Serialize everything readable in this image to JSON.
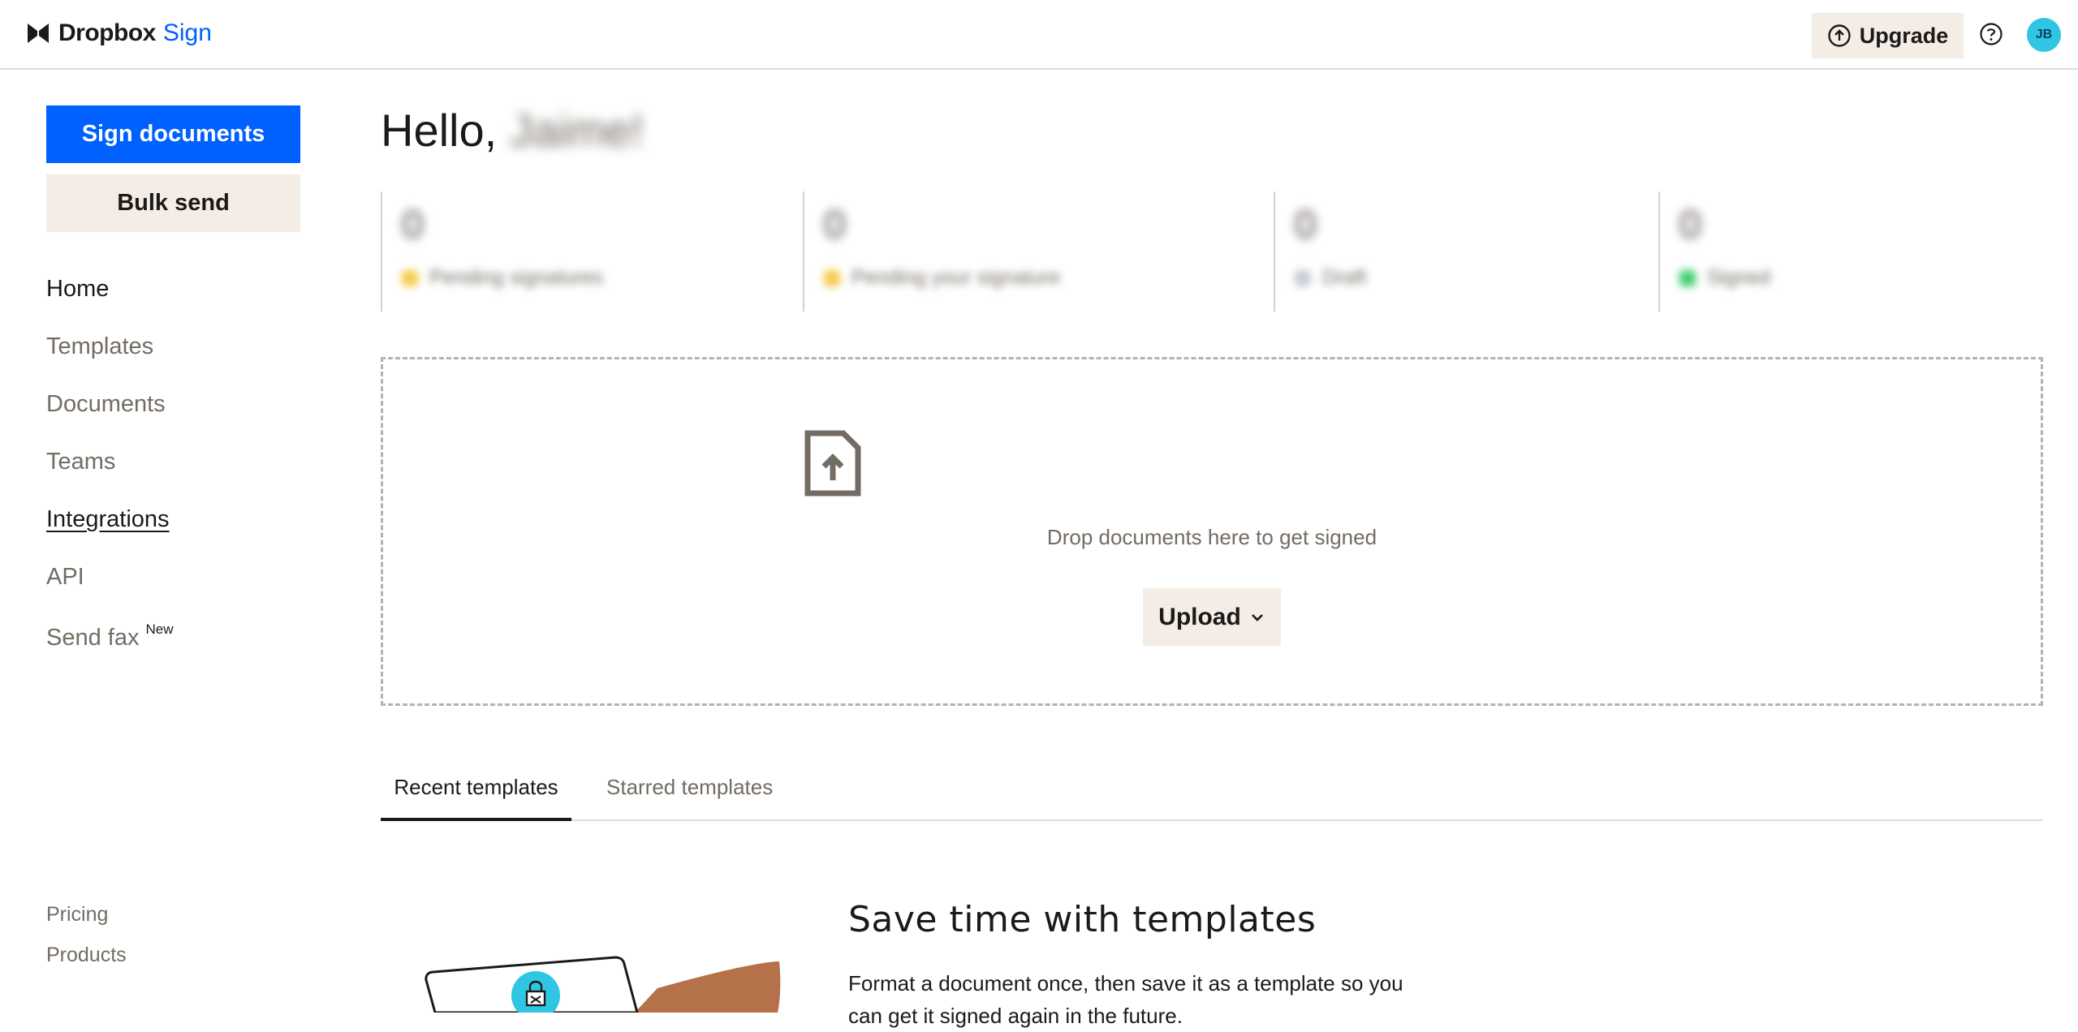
{
  "app": {
    "logo_text": "Dropbox",
    "logo_sub": "Sign"
  },
  "header": {
    "upgrade_label": "Upgrade",
    "avatar_initials": "JB"
  },
  "sidebar": {
    "sign_button": "Sign documents",
    "bulk_button": "Bulk send",
    "nav": [
      {
        "label": "Home"
      },
      {
        "label": "Templates"
      },
      {
        "label": "Documents"
      },
      {
        "label": "Teams"
      },
      {
        "label": "Integrations"
      },
      {
        "label": "API"
      },
      {
        "label": "Send fax",
        "badge": "New"
      }
    ],
    "footer": [
      "Pricing",
      "Products"
    ]
  },
  "main": {
    "greeting": "Hello,",
    "user_name": "Jaime!",
    "stats": [
      {
        "count": "0",
        "label": "Pending signatures",
        "color": "#f5c94a"
      },
      {
        "count": "0",
        "label": "Pending your signature",
        "color": "#f5c94a"
      },
      {
        "count": "0",
        "label": "Draft",
        "color": "#c7cbd4"
      },
      {
        "count": "0",
        "label": "Signed",
        "color": "#3ccf6e"
      }
    ],
    "dropzone": {
      "text": "Drop documents here to get signed",
      "upload_label": "Upload"
    },
    "tabs": [
      {
        "label": "Recent templates"
      },
      {
        "label": "Starred templates"
      }
    ],
    "promo": {
      "title": "Save time with templates",
      "text": "Format a document once, then save it as a template so you can get it signed again in the future."
    }
  },
  "colors": {
    "accent": "#0061fe",
    "beige": "#f3ede6",
    "text": "#1e1919",
    "muted": "#736c64"
  }
}
